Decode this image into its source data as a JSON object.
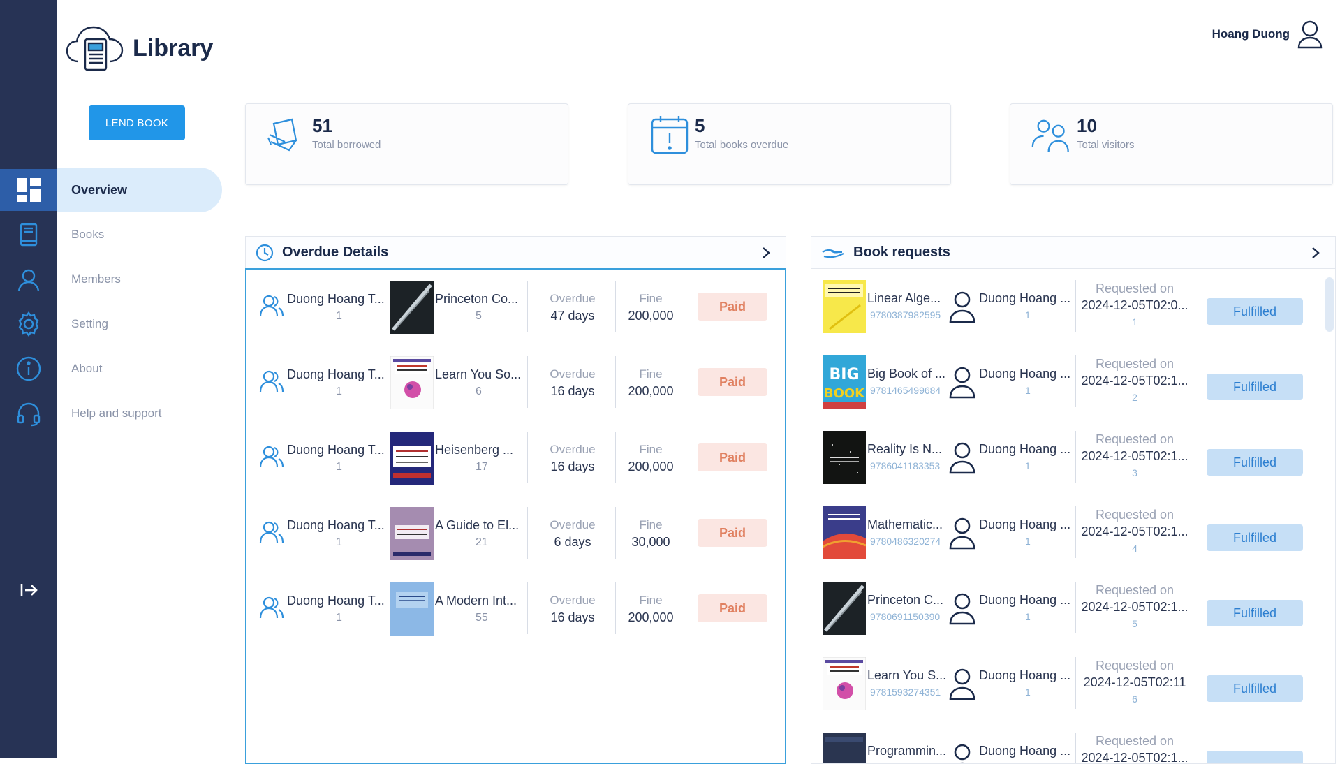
{
  "app": {
    "title": "Library"
  },
  "user": {
    "name": "Hoang Duong"
  },
  "actions": {
    "lend_label": "LEND BOOK"
  },
  "nav": [
    {
      "label": "Overview",
      "icon": "dashboard-icon",
      "active": true
    },
    {
      "label": "Books",
      "icon": "book-icon"
    },
    {
      "label": "Members",
      "icon": "user-icon"
    },
    {
      "label": "Setting",
      "icon": "gear-icon"
    },
    {
      "label": "About",
      "icon": "info-icon"
    },
    {
      "label": "Help and support",
      "icon": "headset-icon"
    }
  ],
  "stats": [
    {
      "value": "51",
      "label": "Total borrowed",
      "icon": "books-icon"
    },
    {
      "value": "5",
      "label": "Total books overdue",
      "icon": "calendar-alert-icon"
    },
    {
      "value": "10",
      "label": "Total visitors",
      "icon": "users-icon"
    }
  ],
  "overdue": {
    "title": "Overdue Details",
    "overdue_label": "Overdue",
    "fine_label": "Fine",
    "rows": [
      {
        "member": "Duong Hoang T...",
        "member_id": "1",
        "book": "Princeton Co...",
        "book_qty": "5",
        "overdue": "47 days",
        "fine": "200,000",
        "status": "Paid",
        "cover": "dark"
      },
      {
        "member": "Duong Hoang T...",
        "member_id": "1",
        "book": "Learn You So...",
        "book_qty": "6",
        "overdue": "16 days",
        "fine": "200,000",
        "status": "Paid",
        "cover": "lyse"
      },
      {
        "member": "Duong Hoang T...",
        "member_id": "1",
        "book": "Heisenberg ...",
        "book_qty": "17",
        "overdue": "16 days",
        "fine": "200,000",
        "status": "Paid",
        "cover": "memoirs"
      },
      {
        "member": "Duong Hoang T...",
        "member_id": "1",
        "book": "A Guide to El...",
        "book_qty": "21",
        "overdue": "6 days",
        "fine": "30,000",
        "status": "Paid",
        "cover": "guide"
      },
      {
        "member": "Duong Hoang T...",
        "member_id": "1",
        "book": "A Modern Int...",
        "book_qty": "55",
        "overdue": "16 days",
        "fine": "200,000",
        "status": "Paid",
        "cover": "modern"
      }
    ]
  },
  "requests": {
    "title": "Book requests",
    "requested_label": "Requested on",
    "rows": [
      {
        "book": "Linear Alge...",
        "isbn": "9780387982595",
        "member": "Duong Hoang ...",
        "member_id": "1",
        "date": "2024-12-05T02:0...",
        "req_id": "1",
        "status": "Fulfilled",
        "cover": "linear"
      },
      {
        "book": "Big Book of ...",
        "isbn": "9781465499684",
        "member": "Duong Hoang ...",
        "member_id": "1",
        "date": "2024-12-05T02:1...",
        "req_id": "2",
        "status": "Fulfilled",
        "cover": "bigbook"
      },
      {
        "book": "Reality Is N...",
        "isbn": "9786041183353",
        "member": "Duong Hoang ...",
        "member_id": "1",
        "date": "2024-12-05T02:1...",
        "req_id": "3",
        "status": "Fulfilled",
        "cover": "reality"
      },
      {
        "book": "Mathematic...",
        "isbn": "9780486320274",
        "member": "Duong Hoang ...",
        "member_id": "1",
        "date": "2024-12-05T02:1...",
        "req_id": "4",
        "status": "Fulfilled",
        "cover": "math"
      },
      {
        "book": "Princeton C...",
        "isbn": "9780691150390",
        "member": "Duong Hoang ...",
        "member_id": "1",
        "date": "2024-12-05T02:1...",
        "req_id": "5",
        "status": "Fulfilled",
        "cover": "dark"
      },
      {
        "book": "Learn You S...",
        "isbn": "9781593274351",
        "member": "Duong Hoang ...",
        "member_id": "1",
        "date": "2024-12-05T02:11",
        "req_id": "6",
        "status": "Fulfilled",
        "cover": "lyse"
      },
      {
        "book": "Programmin...",
        "isbn": "",
        "member": "Duong Hoang ...",
        "member_id": "",
        "date": "2024-12-05T02:1...",
        "req_id": "",
        "status": "",
        "cover": "prog"
      }
    ]
  },
  "colors": {
    "sidebar": "#273355",
    "accent": "#2196e8",
    "paid_bg": "#fbe6e2",
    "fulfilled_bg": "#c6dff6"
  }
}
